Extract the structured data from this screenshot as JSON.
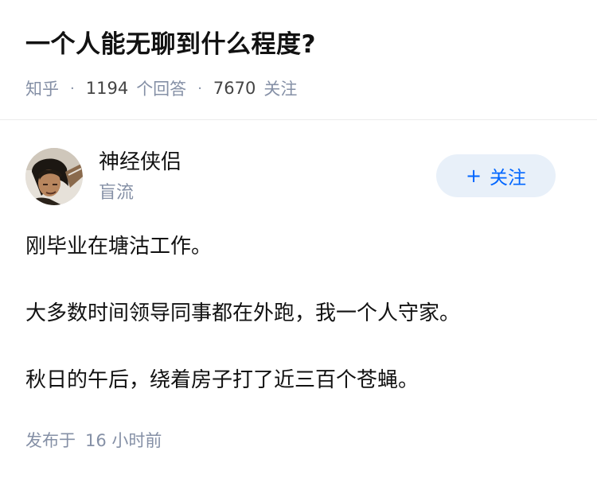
{
  "question": {
    "title": "一个人能无聊到什么程度?",
    "source": "知乎",
    "answers_count": "1194",
    "answers_label": "个回答",
    "followers_count": "7670",
    "followers_label": "关注"
  },
  "author": {
    "name": "神经侠侣",
    "bio": "盲流",
    "follow_plus": "+",
    "follow_label": "关注"
  },
  "answer": {
    "paragraphs": [
      "刚毕业在塘沽工作。",
      "大多数时间领导同事都在外跑，我一个人守家。",
      "秋日的午后，绕着房子打了近三百个苍蝇。"
    ],
    "published_label": "发布于",
    "published_time": "16 小时前"
  }
}
